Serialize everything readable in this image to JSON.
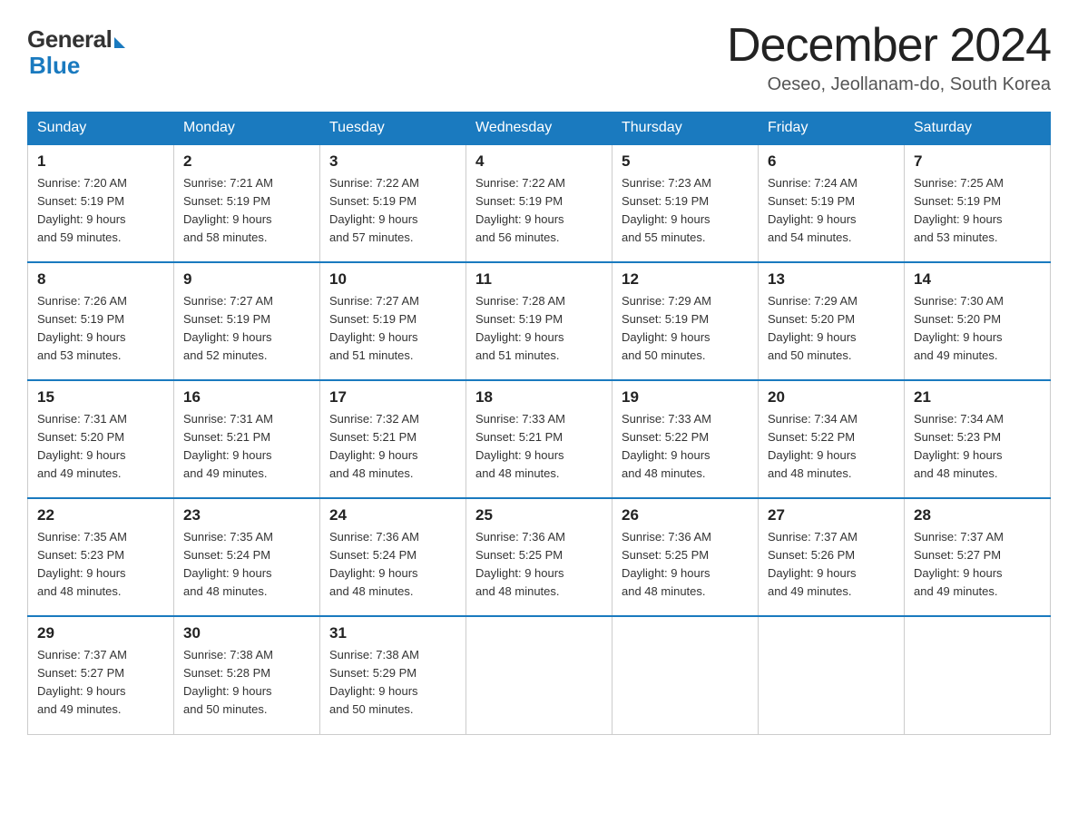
{
  "header": {
    "logo_general": "General",
    "logo_blue": "Blue",
    "month_year": "December 2024",
    "location": "Oeseo, Jeollanam-do, South Korea"
  },
  "days_of_week": [
    "Sunday",
    "Monday",
    "Tuesday",
    "Wednesday",
    "Thursday",
    "Friday",
    "Saturday"
  ],
  "weeks": [
    [
      {
        "day": "1",
        "sunrise": "7:20 AM",
        "sunset": "5:19 PM",
        "daylight": "9 hours and 59 minutes."
      },
      {
        "day": "2",
        "sunrise": "7:21 AM",
        "sunset": "5:19 PM",
        "daylight": "9 hours and 58 minutes."
      },
      {
        "day": "3",
        "sunrise": "7:22 AM",
        "sunset": "5:19 PM",
        "daylight": "9 hours and 57 minutes."
      },
      {
        "day": "4",
        "sunrise": "7:22 AM",
        "sunset": "5:19 PM",
        "daylight": "9 hours and 56 minutes."
      },
      {
        "day": "5",
        "sunrise": "7:23 AM",
        "sunset": "5:19 PM",
        "daylight": "9 hours and 55 minutes."
      },
      {
        "day": "6",
        "sunrise": "7:24 AM",
        "sunset": "5:19 PM",
        "daylight": "9 hours and 54 minutes."
      },
      {
        "day": "7",
        "sunrise": "7:25 AM",
        "sunset": "5:19 PM",
        "daylight": "9 hours and 53 minutes."
      }
    ],
    [
      {
        "day": "8",
        "sunrise": "7:26 AM",
        "sunset": "5:19 PM",
        "daylight": "9 hours and 53 minutes."
      },
      {
        "day": "9",
        "sunrise": "7:27 AM",
        "sunset": "5:19 PM",
        "daylight": "9 hours and 52 minutes."
      },
      {
        "day": "10",
        "sunrise": "7:27 AM",
        "sunset": "5:19 PM",
        "daylight": "9 hours and 51 minutes."
      },
      {
        "day": "11",
        "sunrise": "7:28 AM",
        "sunset": "5:19 PM",
        "daylight": "9 hours and 51 minutes."
      },
      {
        "day": "12",
        "sunrise": "7:29 AM",
        "sunset": "5:19 PM",
        "daylight": "9 hours and 50 minutes."
      },
      {
        "day": "13",
        "sunrise": "7:29 AM",
        "sunset": "5:20 PM",
        "daylight": "9 hours and 50 minutes."
      },
      {
        "day": "14",
        "sunrise": "7:30 AM",
        "sunset": "5:20 PM",
        "daylight": "9 hours and 49 minutes."
      }
    ],
    [
      {
        "day": "15",
        "sunrise": "7:31 AM",
        "sunset": "5:20 PM",
        "daylight": "9 hours and 49 minutes."
      },
      {
        "day": "16",
        "sunrise": "7:31 AM",
        "sunset": "5:21 PM",
        "daylight": "9 hours and 49 minutes."
      },
      {
        "day": "17",
        "sunrise": "7:32 AM",
        "sunset": "5:21 PM",
        "daylight": "9 hours and 48 minutes."
      },
      {
        "day": "18",
        "sunrise": "7:33 AM",
        "sunset": "5:21 PM",
        "daylight": "9 hours and 48 minutes."
      },
      {
        "day": "19",
        "sunrise": "7:33 AM",
        "sunset": "5:22 PM",
        "daylight": "9 hours and 48 minutes."
      },
      {
        "day": "20",
        "sunrise": "7:34 AM",
        "sunset": "5:22 PM",
        "daylight": "9 hours and 48 minutes."
      },
      {
        "day": "21",
        "sunrise": "7:34 AM",
        "sunset": "5:23 PM",
        "daylight": "9 hours and 48 minutes."
      }
    ],
    [
      {
        "day": "22",
        "sunrise": "7:35 AM",
        "sunset": "5:23 PM",
        "daylight": "9 hours and 48 minutes."
      },
      {
        "day": "23",
        "sunrise": "7:35 AM",
        "sunset": "5:24 PM",
        "daylight": "9 hours and 48 minutes."
      },
      {
        "day": "24",
        "sunrise": "7:36 AM",
        "sunset": "5:24 PM",
        "daylight": "9 hours and 48 minutes."
      },
      {
        "day": "25",
        "sunrise": "7:36 AM",
        "sunset": "5:25 PM",
        "daylight": "9 hours and 48 minutes."
      },
      {
        "day": "26",
        "sunrise": "7:36 AM",
        "sunset": "5:25 PM",
        "daylight": "9 hours and 48 minutes."
      },
      {
        "day": "27",
        "sunrise": "7:37 AM",
        "sunset": "5:26 PM",
        "daylight": "9 hours and 49 minutes."
      },
      {
        "day": "28",
        "sunrise": "7:37 AM",
        "sunset": "5:27 PM",
        "daylight": "9 hours and 49 minutes."
      }
    ],
    [
      {
        "day": "29",
        "sunrise": "7:37 AM",
        "sunset": "5:27 PM",
        "daylight": "9 hours and 49 minutes."
      },
      {
        "day": "30",
        "sunrise": "7:38 AM",
        "sunset": "5:28 PM",
        "daylight": "9 hours and 50 minutes."
      },
      {
        "day": "31",
        "sunrise": "7:38 AM",
        "sunset": "5:29 PM",
        "daylight": "9 hours and 50 minutes."
      },
      null,
      null,
      null,
      null
    ]
  ]
}
